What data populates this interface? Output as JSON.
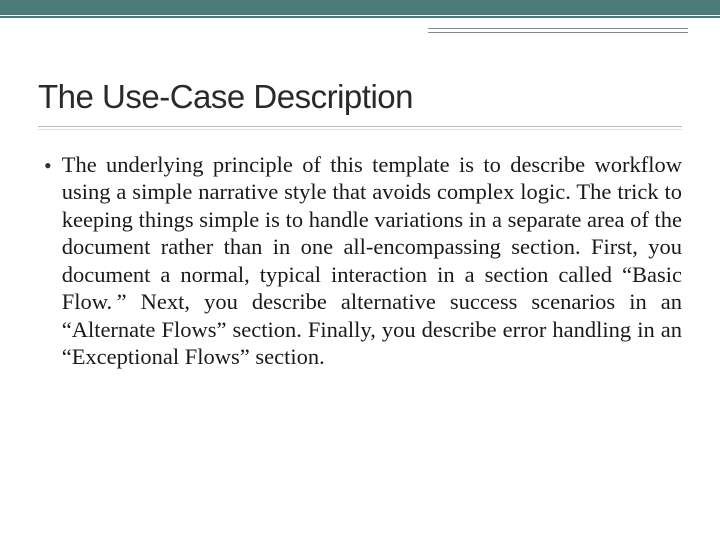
{
  "slide": {
    "title": "The Use-Case Description",
    "bullet": "•",
    "body": "The underlying principle of this template is to describe workflow using a simple narrative style that avoids complex logic. The trick to keeping things simple is to handle variations in a separate area of the document rather than in one all-encompassing section. First, you document a normal, typical interaction in a section called “Basic Flow. ” Next, you describe alternative success scenarios in an “Alternate Flows” section. Finally, you describe error handling in an “Exceptional Flows” section."
  },
  "theme": {
    "accent": "#4a7a7a"
  }
}
